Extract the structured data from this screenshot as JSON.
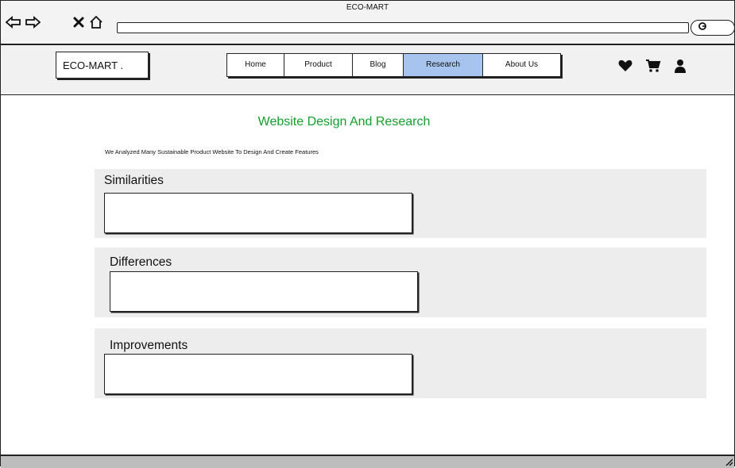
{
  "window": {
    "title": "ECO-MART"
  },
  "browser": {
    "back_icon": "back-arrow-icon",
    "forward_icon": "forward-arrow-icon",
    "close_icon": "close-icon",
    "home_icon": "home-icon",
    "search_icon": "search-icon"
  },
  "header": {
    "logo": "ECO-MART .",
    "nav": [
      {
        "label": "Home"
      },
      {
        "label": "Product"
      },
      {
        "label": "Blog"
      },
      {
        "label": "Research"
      },
      {
        "label": "About Us"
      }
    ],
    "active_tab": "Research",
    "icons": [
      "heart-icon",
      "cart-icon",
      "user-icon"
    ]
  },
  "main": {
    "title": "Website Design And Research",
    "subtitle": "We Analyzed Many Sustainable Product Website To Design And Create Features",
    "sections": [
      {
        "heading": "Similarities",
        "content": ""
      },
      {
        "heading": "Differences",
        "content": ""
      },
      {
        "heading": "Improvements",
        "content": ""
      }
    ]
  },
  "colors": {
    "accent_title": "#12a12a",
    "active_tab": "#a7c4ee",
    "panel_bg": "#ededed"
  }
}
